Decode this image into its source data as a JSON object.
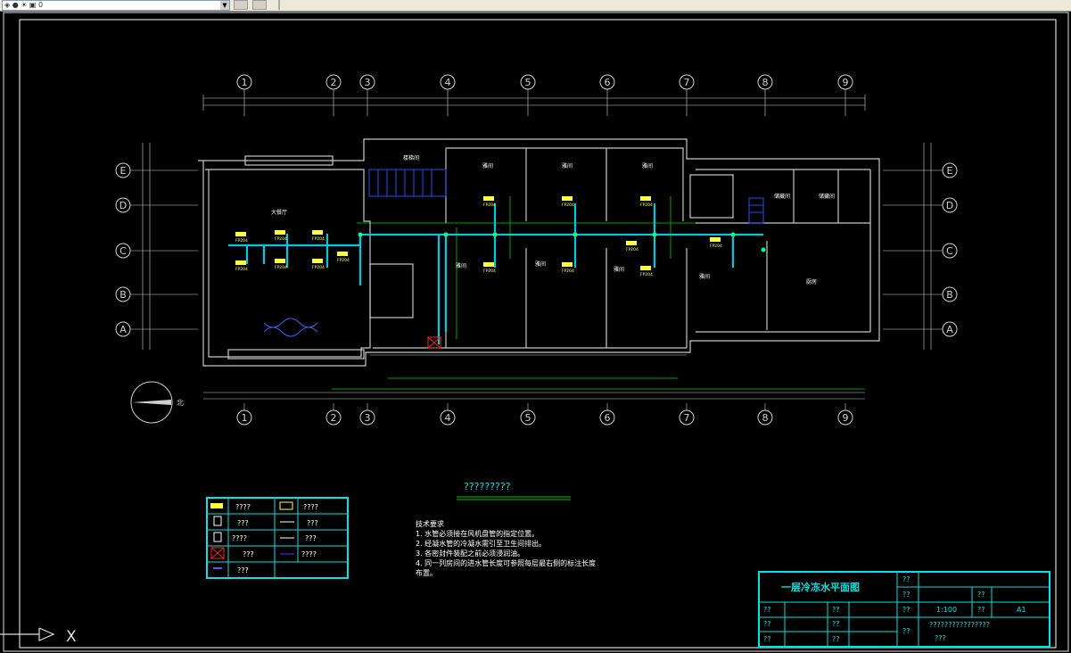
{
  "toolbar": {
    "layer_value": "0",
    "icons": [
      "layer-icon",
      "bulb-icon",
      "sun-icon",
      "lock-icon",
      "color-swatch-icon",
      "layer-previous-icon",
      "layer-states-icon"
    ]
  },
  "drawing": {
    "grid_columns": [
      "1",
      "2",
      "3",
      "4",
      "5",
      "6",
      "7",
      "8",
      "9"
    ],
    "grid_rows": [
      "E",
      "D",
      "C",
      "B",
      "A"
    ],
    "rooms": {
      "banquet_hall": "大餐厅",
      "kitchen": "厨房",
      "private_room": "雅间",
      "storage": "储藏间",
      "stair": "楼梯间"
    },
    "fan_coil_tag": "FP204",
    "north_label": "北",
    "legend_title": "?????????",
    "legend": [
      [
        "????",
        "????"
      ],
      [
        "???",
        "???"
      ],
      [
        "????",
        "???"
      ],
      [
        "???",
        "????"
      ],
      [
        "???"
      ]
    ],
    "notes": {
      "heading": "技术要求",
      "lines": [
        "1. 水管必须接在风机盘管的指定位置。",
        "2. 经凝水管的冷凝水需引至卫生间排出。",
        "3. 各密封件装配之前必须浸润油。",
        "4. 同一列房间的进水管长度可参照每层最右侧的标注长度",
        "布置。"
      ]
    }
  },
  "title_block": {
    "title": "一层冷冻水平面图",
    "r1_label": "??",
    "r2_label": "??",
    "r2_label2": "??",
    "r3_a": "??",
    "r3_b": "??",
    "r3_scale_label": "??",
    "r3_scale": "1:100",
    "r3_size_label": "??",
    "r3_size": "A1",
    "r4_a": "??",
    "r4_b": "??",
    "r4_label": "??",
    "r4_value": "????????????????",
    "r5_a": "??",
    "r5_b": "??",
    "r5_value": "???"
  },
  "ucs": {
    "x_label": "X"
  },
  "colors": {
    "background": "#000000",
    "wall": "#c8c8c8",
    "pipe": "#00c8e0",
    "dimension": "#00d000",
    "equipment": "#ffff40",
    "title_block": "#00e5e5",
    "stair": "#2050ff"
  }
}
